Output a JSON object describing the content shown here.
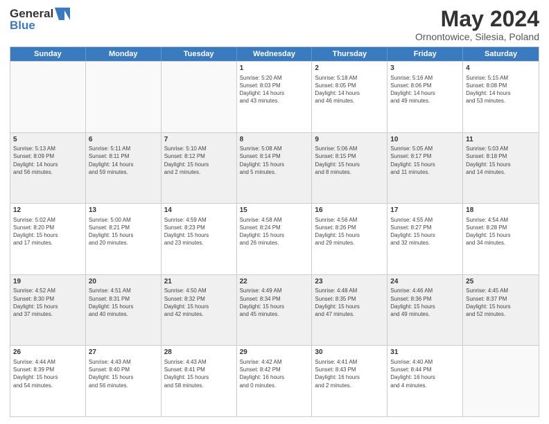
{
  "header": {
    "logo_general": "General",
    "logo_blue": "Blue",
    "title": "May 2024",
    "subtitle": "Ornontowice, Silesia, Poland"
  },
  "days": [
    "Sunday",
    "Monday",
    "Tuesday",
    "Wednesday",
    "Thursday",
    "Friday",
    "Saturday"
  ],
  "weeks": [
    [
      {
        "num": "",
        "info": ""
      },
      {
        "num": "",
        "info": ""
      },
      {
        "num": "",
        "info": ""
      },
      {
        "num": "1",
        "info": "Sunrise: 5:20 AM\nSunset: 8:03 PM\nDaylight: 14 hours\nand 43 minutes."
      },
      {
        "num": "2",
        "info": "Sunrise: 5:18 AM\nSunset: 8:05 PM\nDaylight: 14 hours\nand 46 minutes."
      },
      {
        "num": "3",
        "info": "Sunrise: 5:16 AM\nSunset: 8:06 PM\nDaylight: 14 hours\nand 49 minutes."
      },
      {
        "num": "4",
        "info": "Sunrise: 5:15 AM\nSunset: 8:08 PM\nDaylight: 14 hours\nand 53 minutes."
      }
    ],
    [
      {
        "num": "5",
        "info": "Sunrise: 5:13 AM\nSunset: 8:09 PM\nDaylight: 14 hours\nand 56 minutes."
      },
      {
        "num": "6",
        "info": "Sunrise: 5:11 AM\nSunset: 8:11 PM\nDaylight: 14 hours\nand 59 minutes."
      },
      {
        "num": "7",
        "info": "Sunrise: 5:10 AM\nSunset: 8:12 PM\nDaylight: 15 hours\nand 2 minutes."
      },
      {
        "num": "8",
        "info": "Sunrise: 5:08 AM\nSunset: 8:14 PM\nDaylight: 15 hours\nand 5 minutes."
      },
      {
        "num": "9",
        "info": "Sunrise: 5:06 AM\nSunset: 8:15 PM\nDaylight: 15 hours\nand 8 minutes."
      },
      {
        "num": "10",
        "info": "Sunrise: 5:05 AM\nSunset: 8:17 PM\nDaylight: 15 hours\nand 11 minutes."
      },
      {
        "num": "11",
        "info": "Sunrise: 5:03 AM\nSunset: 8:18 PM\nDaylight: 15 hours\nand 14 minutes."
      }
    ],
    [
      {
        "num": "12",
        "info": "Sunrise: 5:02 AM\nSunset: 8:20 PM\nDaylight: 15 hours\nand 17 minutes."
      },
      {
        "num": "13",
        "info": "Sunrise: 5:00 AM\nSunset: 8:21 PM\nDaylight: 15 hours\nand 20 minutes."
      },
      {
        "num": "14",
        "info": "Sunrise: 4:59 AM\nSunset: 8:23 PM\nDaylight: 15 hours\nand 23 minutes."
      },
      {
        "num": "15",
        "info": "Sunrise: 4:58 AM\nSunset: 8:24 PM\nDaylight: 15 hours\nand 26 minutes."
      },
      {
        "num": "16",
        "info": "Sunrise: 4:56 AM\nSunset: 8:26 PM\nDaylight: 15 hours\nand 29 minutes."
      },
      {
        "num": "17",
        "info": "Sunrise: 4:55 AM\nSunset: 8:27 PM\nDaylight: 15 hours\nand 32 minutes."
      },
      {
        "num": "18",
        "info": "Sunrise: 4:54 AM\nSunset: 8:28 PM\nDaylight: 15 hours\nand 34 minutes."
      }
    ],
    [
      {
        "num": "19",
        "info": "Sunrise: 4:52 AM\nSunset: 8:30 PM\nDaylight: 15 hours\nand 37 minutes."
      },
      {
        "num": "20",
        "info": "Sunrise: 4:51 AM\nSunset: 8:31 PM\nDaylight: 15 hours\nand 40 minutes."
      },
      {
        "num": "21",
        "info": "Sunrise: 4:50 AM\nSunset: 8:32 PM\nDaylight: 15 hours\nand 42 minutes."
      },
      {
        "num": "22",
        "info": "Sunrise: 4:49 AM\nSunset: 8:34 PM\nDaylight: 15 hours\nand 45 minutes."
      },
      {
        "num": "23",
        "info": "Sunrise: 4:48 AM\nSunset: 8:35 PM\nDaylight: 15 hours\nand 47 minutes."
      },
      {
        "num": "24",
        "info": "Sunrise: 4:46 AM\nSunset: 8:36 PM\nDaylight: 15 hours\nand 49 minutes."
      },
      {
        "num": "25",
        "info": "Sunrise: 4:45 AM\nSunset: 8:37 PM\nDaylight: 15 hours\nand 52 minutes."
      }
    ],
    [
      {
        "num": "26",
        "info": "Sunrise: 4:44 AM\nSunset: 8:39 PM\nDaylight: 15 hours\nand 54 minutes."
      },
      {
        "num": "27",
        "info": "Sunrise: 4:43 AM\nSunset: 8:40 PM\nDaylight: 15 hours\nand 56 minutes."
      },
      {
        "num": "28",
        "info": "Sunrise: 4:43 AM\nSunset: 8:41 PM\nDaylight: 15 hours\nand 58 minutes."
      },
      {
        "num": "29",
        "info": "Sunrise: 4:42 AM\nSunset: 8:42 PM\nDaylight: 16 hours\nand 0 minutes."
      },
      {
        "num": "30",
        "info": "Sunrise: 4:41 AM\nSunset: 8:43 PM\nDaylight: 16 hours\nand 2 minutes."
      },
      {
        "num": "31",
        "info": "Sunrise: 4:40 AM\nSunset: 8:44 PM\nDaylight: 16 hours\nand 4 minutes."
      },
      {
        "num": "",
        "info": ""
      }
    ]
  ]
}
